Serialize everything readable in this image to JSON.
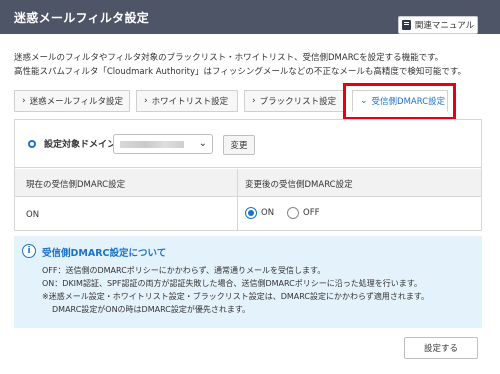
{
  "header": {
    "title": "迷惑メールフィルタ設定",
    "manual_label": "関連マニュアル"
  },
  "description": {
    "line1": "迷惑メールのフィルタやフィルタ対象のブラックリスト・ホワイトリスト、受信側DMARCを設定する機能です。",
    "line2": "高性能スパムフィルタ「Cloudmark Authority」はフィッシングメールなどの不正なメールも高精度で検知可能です。"
  },
  "tabs": [
    {
      "label": "迷惑メールフィルタ設定",
      "icon": "chevron-right-icon",
      "active": false
    },
    {
      "label": "ホワイトリスト設定",
      "icon": "chevron-right-icon",
      "active": false
    },
    {
      "label": "ブラックリスト設定",
      "icon": "chevron-right-icon",
      "active": false
    },
    {
      "label": "受信側DMARC設定",
      "icon": "chevron-down-icon",
      "active": true
    }
  ],
  "domain": {
    "label": "設定対象ドメイン",
    "change_label": "変更"
  },
  "table": {
    "headers": [
      "現在の受信側DMARC設定",
      "変更後の受信側DMARC設定"
    ],
    "current_value": "ON",
    "options": [
      {
        "label": "ON",
        "checked": true
      },
      {
        "label": "OFF",
        "checked": false
      }
    ]
  },
  "info": {
    "title": "受信側DMARC設定について",
    "lines": [
      "OFF：送信側のDMARCポリシーにかかわらず、通常通りメールを受信します。",
      "ON：DKIM認証、SPF認証の両方が認証失敗した場合、送信側DMARCポリシーに沿った処理を行います。",
      "※迷惑メール設定・ホワイトリスト設定・ブラックリスト設定は、DMARC設定にかかわらず適用されます。",
      "DMARC設定がONの時はDMARC設定が優先されます。"
    ]
  },
  "submit_label": "設定する",
  "colors": {
    "header_bg": "#4d5566",
    "accent": "#1a73c8",
    "highlight": "#e60012",
    "info_bg": "#e4f2fb"
  }
}
